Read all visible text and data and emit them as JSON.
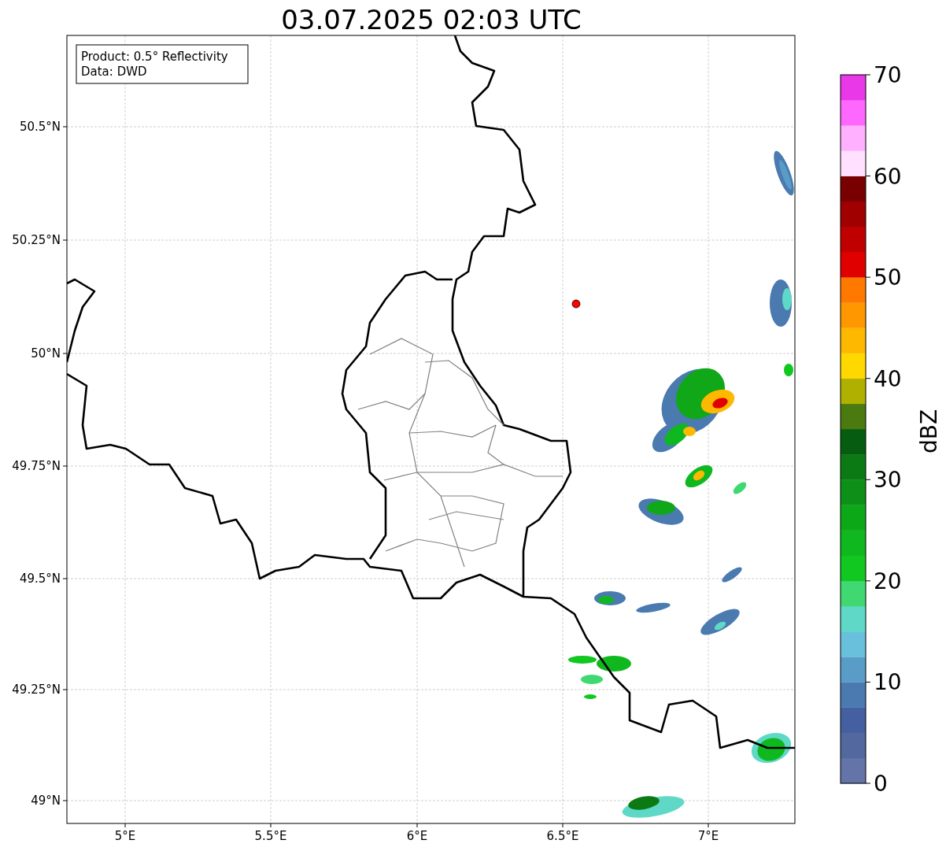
{
  "title": "03.07.2025 02:03 UTC",
  "legend": {
    "lines": [
      "Product: 0.5° Reflectivity",
      "Data: DWD"
    ]
  },
  "x_axis": {
    "ticks": [
      "5°E",
      "5.5°E",
      "6°E",
      "6.5°E",
      "7°E"
    ]
  },
  "y_axis": {
    "ticks": [
      "50.5°N",
      "50.25°N",
      "50°N",
      "49.75°N",
      "49.5°N",
      "49.25°N",
      "49°N"
    ]
  },
  "colorbar": {
    "label": "dBZ",
    "ticks": [
      "70",
      "60",
      "50",
      "40",
      "30",
      "20",
      "10",
      "0"
    ],
    "bands": [
      {
        "color": "#6474a8"
      },
      {
        "color": "#5468a0"
      },
      {
        "color": "#4560a0"
      },
      {
        "color": "#4a7ab0"
      },
      {
        "color": "#5a9cc8"
      },
      {
        "color": "#68c0dc"
      },
      {
        "color": "#60d8c8"
      },
      {
        "color": "#40d870"
      },
      {
        "color": "#10c820"
      },
      {
        "color": "#10b820"
      },
      {
        "color": "#0ca818"
      },
      {
        "color": "#0c9018"
      },
      {
        "color": "#0b7a14"
      },
      {
        "color": "#065c10"
      },
      {
        "color": "#4a7a10"
      },
      {
        "color": "#b0b000"
      },
      {
        "color": "#ffd800"
      },
      {
        "color": "#ffb800"
      },
      {
        "color": "#ff9800"
      },
      {
        "color": "#ff7800"
      },
      {
        "color": "#e00000"
      },
      {
        "color": "#c00000"
      },
      {
        "color": "#a00000"
      },
      {
        "color": "#780000"
      },
      {
        "color": "#ffe0ff"
      },
      {
        "color": "#ffb0ff"
      },
      {
        "color": "#ff68ff"
      },
      {
        "color": "#e838e8"
      }
    ]
  }
}
